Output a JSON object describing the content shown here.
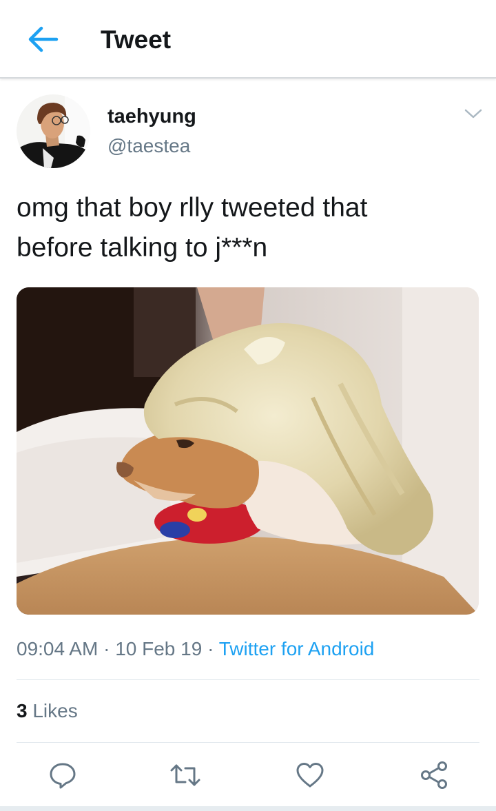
{
  "header": {
    "back_icon": "arrow-left-icon",
    "title": "Tweet"
  },
  "tweet": {
    "author": {
      "display_name": "taehyung",
      "handle": "@taestea",
      "avatar": "profile-photo"
    },
    "menu_icon": "chevron-down-icon",
    "text_line1": "omg that boy rlly tweeted that",
    "text_line2": "before talking to j***n",
    "media": {
      "description_icon": "photo",
      "kind": "image"
    },
    "time": "09:04 AM",
    "separator": "·",
    "date": "10 Feb 19",
    "source": "Twitter for Android",
    "likes_count": "3",
    "likes_label": "Likes"
  },
  "actions": [
    {
      "icon": "reply-icon"
    },
    {
      "icon": "retweet-icon"
    },
    {
      "icon": "like-heart-icon"
    },
    {
      "icon": "share-icon"
    }
  ],
  "colors": {
    "accent": "#1da1f2",
    "secondary_text": "#657786",
    "primary_text": "#14171a",
    "divider": "#e1e8ed"
  }
}
